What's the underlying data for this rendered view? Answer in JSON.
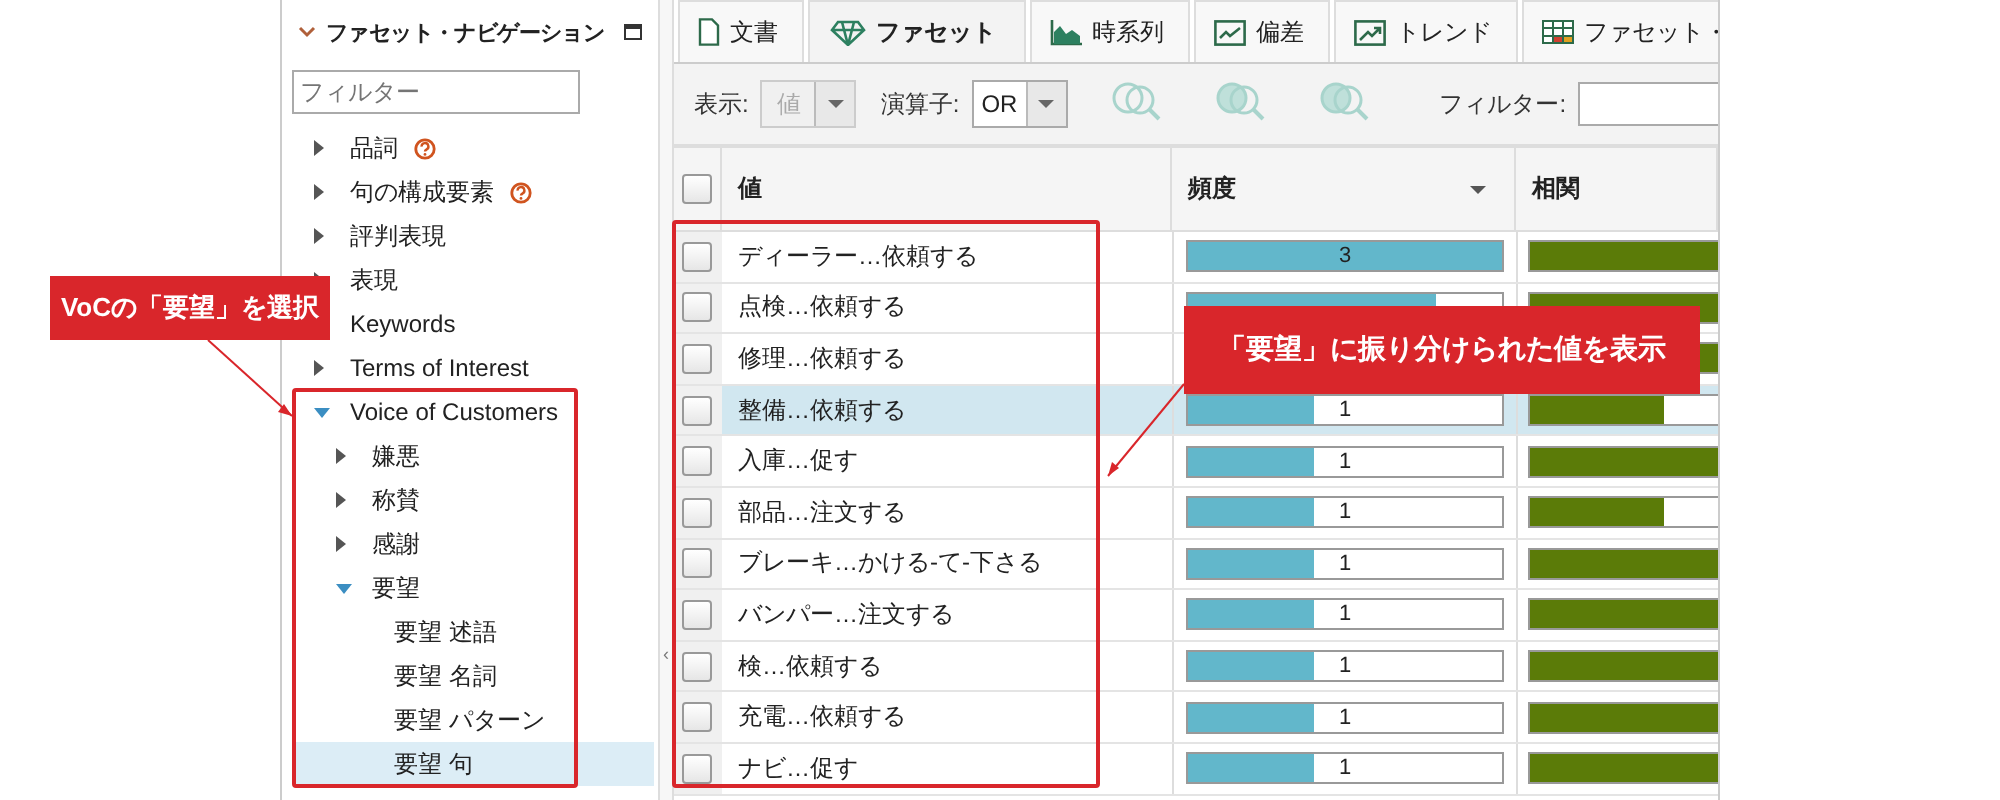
{
  "facet_navigation": {
    "title": "ファセット・ナビゲーション",
    "filter": {
      "placeholder": "フィルター"
    },
    "items": [
      {
        "label": "品詞",
        "help": true,
        "expanded": false,
        "selected": false
      },
      {
        "label": "句の構成要素",
        "help": true,
        "expanded": false,
        "selected": false
      },
      {
        "label": "評判表現",
        "expanded": false,
        "selected": false
      },
      {
        "label": "表現",
        "expanded": false,
        "selected": false
      },
      {
        "label": "Keywords",
        "selected": false
      },
      {
        "label": "Terms of Interest",
        "expanded": false,
        "selected": false
      },
      {
        "label": "Voice of Customers",
        "expanded": true,
        "selected": false,
        "children": [
          {
            "label": "嫌悪",
            "expanded": false,
            "selected": false
          },
          {
            "label": "称賛",
            "expanded": false,
            "selected": false
          },
          {
            "label": "感謝",
            "expanded": false,
            "selected": false
          },
          {
            "label": "要望",
            "expanded": true,
            "selected": false,
            "children": [
              {
                "label": "要望 述語",
                "selected": false
              },
              {
                "label": "要望 名詞",
                "selected": false
              },
              {
                "label": "要望 パターン",
                "selected": false
              },
              {
                "label": "要望 句",
                "selected": true
              }
            ]
          }
        ]
      }
    ]
  },
  "splitter": {
    "handle": "‹"
  },
  "tabs": [
    {
      "label": "文書",
      "kind": "document",
      "selected": false
    },
    {
      "label": "ファセット",
      "kind": "diamond",
      "selected": true
    },
    {
      "label": "時系列",
      "kind": "area",
      "selected": false
    },
    {
      "label": "偏差",
      "kind": "deviation",
      "selected": false
    },
    {
      "label": "トレンド",
      "kind": "trend",
      "selected": false
    },
    {
      "label": "ファセット・",
      "kind": "table",
      "selected": false
    }
  ],
  "toolbar": {
    "view_label": "表示:",
    "view_value": "値",
    "view_disabled": true,
    "operator_label": "演算子:",
    "operator_value": "OR",
    "filter_label": "フィルター:"
  },
  "table": {
    "select_all_checked": false,
    "columns": [
      "値",
      "頻度",
      "相関"
    ],
    "rows": [
      {
        "value": "ディーラー…依頼する",
        "checked": false,
        "selected": false,
        "frequency": {
          "count": "3",
          "level": 1.0
        },
        "correlation": {
          "level": 1.0
        }
      },
      {
        "value": "点検…依頼する",
        "checked": false,
        "selected": false,
        "frequency": {
          "level": 0.79
        },
        "correlation": {
          "level": 1.0
        }
      },
      {
        "value": "修理…依頼する",
        "checked": false,
        "selected": false,
        "correlation": {
          "level": 1.0
        }
      },
      {
        "value": "整備…依頼する",
        "checked": false,
        "selected": true,
        "frequency": {
          "count": "1",
          "level": 0.4
        },
        "correlation": {
          "level": 0.42
        }
      },
      {
        "value": "入庫…促す",
        "checked": false,
        "selected": false,
        "frequency": {
          "count": "1",
          "level": 0.4
        },
        "correlation": {
          "level": 0.74
        }
      },
      {
        "value": "部品…注文する",
        "checked": false,
        "selected": false,
        "frequency": {
          "count": "1",
          "level": 0.4
        },
        "correlation": {
          "level": 0.42
        }
      },
      {
        "value": "ブレーキ…かける-て-下さる",
        "checked": false,
        "selected": false,
        "frequency": {
          "count": "1",
          "level": 0.4
        },
        "correlation": {
          "level": 0.74
        }
      },
      {
        "value": "バンパー…注文する",
        "checked": false,
        "selected": false,
        "frequency": {
          "count": "1",
          "level": 0.4
        },
        "correlation": {
          "level": 0.74
        }
      },
      {
        "value": "検…依頼する",
        "checked": false,
        "selected": false,
        "frequency": {
          "count": "1",
          "level": 0.4
        },
        "correlation": {
          "level": 0.74
        }
      },
      {
        "value": "充電…依頼する",
        "checked": false,
        "selected": false,
        "frequency": {
          "count": "1",
          "level": 0.4
        },
        "correlation": {
          "level": 0.74
        }
      },
      {
        "value": "ナビ…促す",
        "checked": false,
        "selected": false,
        "frequency": {
          "count": "1",
          "level": 0.4
        },
        "correlation": {
          "level": 0.74
        }
      }
    ]
  },
  "annotations": [
    {
      "text": "VoCの「要望」を選択"
    },
    {
      "text": "「要望」に振り分けられた値を表示"
    }
  ]
}
